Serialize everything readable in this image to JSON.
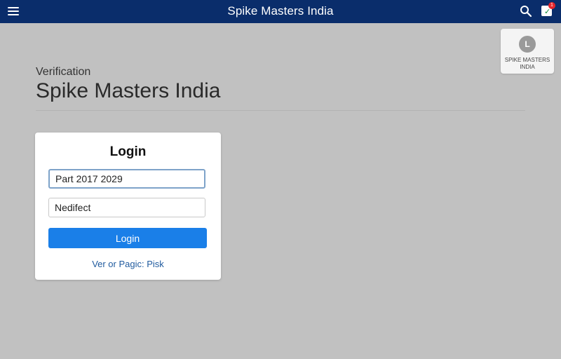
{
  "header": {
    "title": "Spike Masters India",
    "menu_icon": "hamburger-menu-icon",
    "search_icon": "search-icon",
    "cart_icon": "cart-icon",
    "cart_badge": "1",
    "background_color": "#0a2d6b"
  },
  "profile": {
    "avatar_letter": "L",
    "name": "Spike Masters India"
  },
  "page": {
    "subtitle": "Verification",
    "title": "Spike Masters India"
  },
  "login": {
    "heading": "Login",
    "field1_value": "Part 2017 2029",
    "field2_value": "Nedifect",
    "button_label": "Login",
    "button_color": "#1a7fe8",
    "link_text": "Ver or Pagic: Pisk"
  }
}
